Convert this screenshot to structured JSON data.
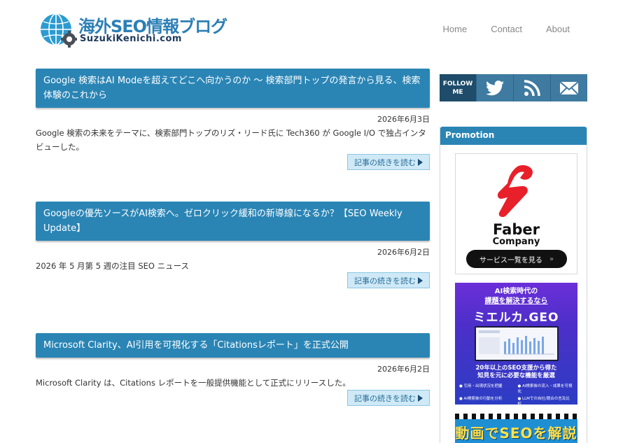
{
  "header": {
    "site_title": "海外SEO情報ブログ",
    "site_subtitle": "SuzukiKenichi.com",
    "nav": [
      {
        "label": "Home"
      },
      {
        "label": "Contact"
      },
      {
        "label": "About"
      }
    ]
  },
  "articles": [
    {
      "title": "Google 検索はAI Modeを超えてどこへ向かうのか 〜 検索部門トップの発言から見る、検索体験のこれから",
      "date": "2026年6月3日",
      "excerpt": "Google 検索の未来をテーマに、検索部門トップのリズ・リード氏に Tech360 が Google I/O で独占インタビューした。",
      "read_more": "記事の続きを読む"
    },
    {
      "title": "Googleの優先ソースがAI検索へ。ゼロクリック緩和の新導線になるか？【SEO Weekly Update】",
      "date": "2026年6月2日",
      "excerpt": "2026 年 5 月第 5 週の注目 SEO ニュース",
      "read_more": "記事の続きを読む"
    },
    {
      "title": "Microsoft Clarity、AI引用を可視化する「Citationsレポート」を正式公開",
      "date": "2026年6月2日",
      "excerpt": "Microsoft Clarity は、Citations レポートを一般提供機能として正式にリリースした。",
      "read_more": "記事の続きを読む"
    }
  ],
  "sidebar": {
    "follow_label_line1": "FOLLOW",
    "follow_label_line2": "ME",
    "follow_icons": [
      "twitter-icon",
      "rss-icon",
      "mail-icon"
    ],
    "promotion_heading": "Promotion",
    "ad1": {
      "brand": "Faber",
      "company": "Company",
      "button": "サービス一覧を見る",
      "arrow": "»",
      "brand_color": "#e8202a"
    },
    "ad2": {
      "top_line1": "AI検索時代の",
      "top_line2": "課題を解決するなら",
      "brand": "ミエルカ.GEO",
      "copy_line1": "20年以上のSEO支援から得た",
      "copy_line2": "知見を元に必要な機能を厳選",
      "features": [
        "● 引用・出現状況を把握",
        "● AI検索後の流入・成果を可視化",
        "● AI検索後の行動を分析",
        "● LLMでの自社/競合の言及比較"
      ]
    },
    "ad3": {
      "text": "動画でSEOを解説"
    }
  },
  "colors": {
    "accent": "#2a85b5",
    "follow_dark": "#1e4c6a",
    "follow_btn": "#3f7aa0",
    "read_more_bg": "#cfe9f6"
  }
}
